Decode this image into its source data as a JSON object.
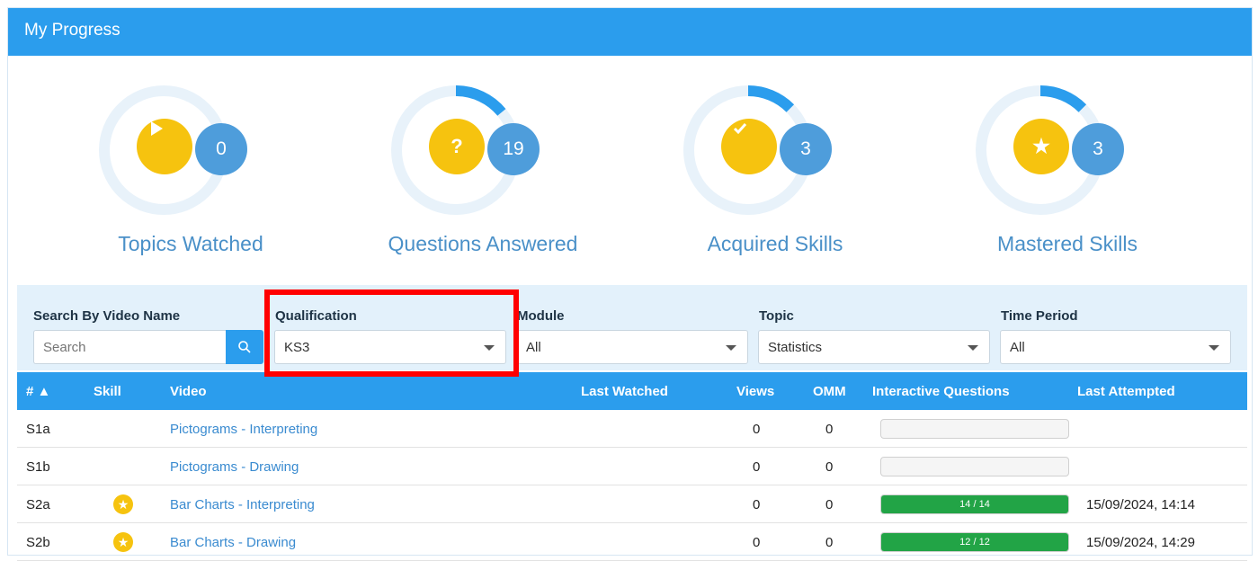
{
  "header": {
    "title": "My Progress"
  },
  "stats": [
    {
      "label": "Topics Watched",
      "count": "0",
      "icon": "play-icon",
      "progress": 0
    },
    {
      "label": "Questions Answered",
      "count": "19",
      "icon": "question-icon",
      "progress": 0.12
    },
    {
      "label": "Acquired Skills",
      "count": "3",
      "icon": "check-icon",
      "progress": 0.1
    },
    {
      "label": "Mastered Skills",
      "count": "3",
      "icon": "star-icon",
      "progress": 0.1
    }
  ],
  "filters": {
    "search": {
      "label": "Search By Video Name",
      "placeholder": "Search"
    },
    "qualification": {
      "label": "Qualification",
      "value": "KS3"
    },
    "module": {
      "label": "Module",
      "value": "All"
    },
    "topic": {
      "label": "Topic",
      "value": "Statistics"
    },
    "time_period": {
      "label": "Time Period",
      "value": "All"
    }
  },
  "table": {
    "columns": [
      "# ▲",
      "Skill",
      "Video",
      "Last Watched",
      "Views",
      "OMM",
      "Interactive Questions",
      "Last Attempted"
    ],
    "rows": [
      {
        "id": "S1a",
        "skill": "",
        "video": "Pictograms - Interpreting",
        "last_watched": "",
        "views": "0",
        "omm": "0",
        "iq": "",
        "iq_progress": 0,
        "last_attempted": ""
      },
      {
        "id": "S1b",
        "skill": "",
        "video": "Pictograms - Drawing",
        "last_watched": "",
        "views": "0",
        "omm": "0",
        "iq": "",
        "iq_progress": 0,
        "last_attempted": ""
      },
      {
        "id": "S2a",
        "skill": "star",
        "video": "Bar Charts - Interpreting",
        "last_watched": "",
        "views": "0",
        "omm": "0",
        "iq": "14 / 14",
        "iq_progress": 1,
        "last_attempted": "15/09/2024, 14:14"
      },
      {
        "id": "S2b",
        "skill": "star",
        "video": "Bar Charts - Drawing",
        "last_watched": "",
        "views": "0",
        "omm": "0",
        "iq": "12 / 12",
        "iq_progress": 1,
        "last_attempted": "15/09/2024, 14:29"
      }
    ]
  },
  "colors": {
    "header": "#2b9ded",
    "accent_yellow": "#f6c30f",
    "count_blue": "#4e9ddb",
    "progress_green": "#22a446",
    "highlight": "#ff0000"
  }
}
